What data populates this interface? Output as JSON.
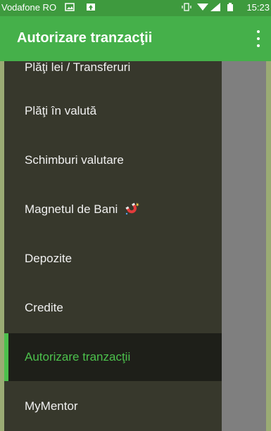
{
  "status_bar": {
    "carrier": "Vodafone RO",
    "time": "15:23",
    "icons": [
      "image-icon",
      "upload-icon",
      "vibrate-icon",
      "wifi-icon",
      "signal-icon",
      "battery-icon"
    ]
  },
  "app_bar": {
    "title": "Autorizare tranzacţii",
    "overflow_icon": "more-vert-icon"
  },
  "drawer": {
    "items": [
      {
        "label": "Plăţi lei / Transferuri"
      },
      {
        "label": "Plăţi în valută"
      },
      {
        "label": "Schimburi valutare"
      },
      {
        "label": "Magnetul de Bani",
        "icon": "magnet-icon"
      },
      {
        "label": "Depozite"
      },
      {
        "label": "Credite"
      },
      {
        "label": "Autorizare tranzacţii",
        "active": true
      },
      {
        "label": "MyMentor"
      }
    ]
  },
  "colors": {
    "status_bar": "#3e9a3e",
    "app_bar": "#45b04a",
    "drawer_bg": "#37382c",
    "active_bg": "#1e1f19",
    "active_text": "#4cc04c",
    "scrim": "#7f7f7f"
  }
}
